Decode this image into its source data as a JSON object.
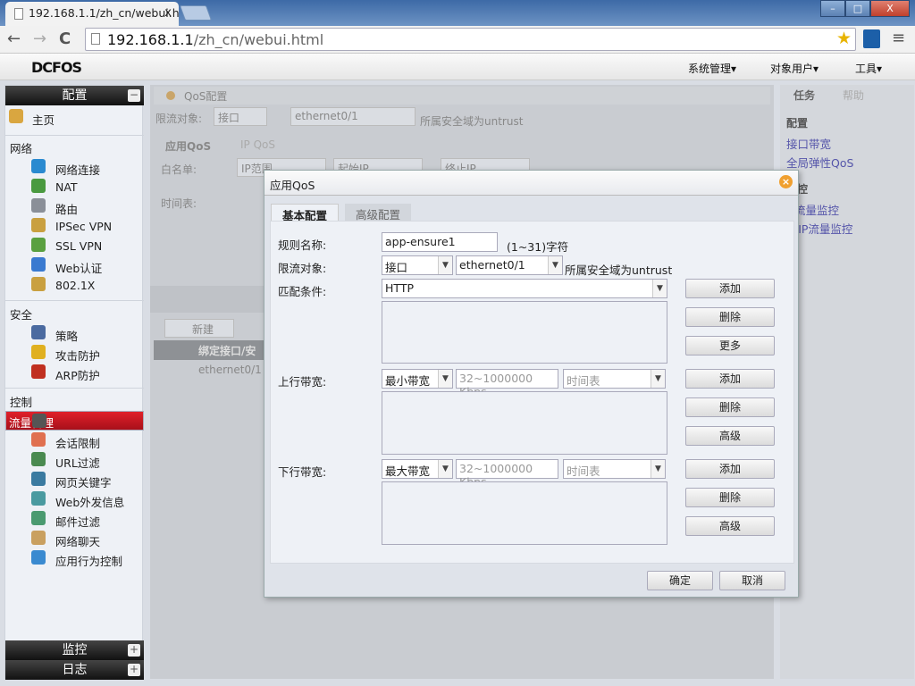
{
  "browser": {
    "tab_title": "192.168.1.1/zh_cn/webui.html",
    "tab_close": "x",
    "url_host": "192.168.1.1",
    "url_path": "/zh_cn/webui.html",
    "window_buttons": [
      "–",
      "□",
      "X"
    ]
  },
  "app": {
    "logo": "DCFOS",
    "menus": [
      "系统管理▾",
      "对象用户▾",
      "工具▾"
    ]
  },
  "sidebar": {
    "config_header": "配置",
    "home": "主页",
    "groups": [
      {
        "label": "网络",
        "items": [
          "网络连接",
          "NAT",
          "路由",
          "IPSec VPN",
          "SSL VPN",
          "Web认证",
          "802.1X"
        ]
      },
      {
        "label": "安全",
        "items": [
          "策略",
          "攻击防护",
          "ARP防护"
        ]
      },
      {
        "label": "控制",
        "items": [
          "流量管理",
          "会话限制",
          "URL过滤",
          "网页关键字",
          "Web外发信息",
          "邮件过滤",
          "网络聊天",
          "应用行为控制"
        ]
      }
    ],
    "selected": "流量管理",
    "monitor_header": "监控",
    "log_header": "日志",
    "expand": "+",
    "collapse": "−"
  },
  "main": {
    "title": "QoS配置",
    "target_label": "限流对象:",
    "target_type": "接口",
    "target_iface": "ethernet0/1",
    "zone_note": "所属安全域为untrust",
    "tabs": [
      "应用QoS",
      "IP QoS"
    ],
    "whitelist_label": "白名单:",
    "whitelist_type": "IP范围",
    "start_ip_ph": "起始IP",
    "end_ip_ph": "终止IP",
    "schedule_label": "时间表:",
    "new_button": "新建",
    "col_header": "绑定接口/安",
    "row_iface": "ethernet0/1"
  },
  "right": {
    "tabs": [
      "任务",
      "帮助"
    ],
    "config_title": "配置",
    "config_links": [
      "接口带宽",
      "全局弹性QoS"
    ],
    "monitor_title": "监控",
    "monitor_links": [
      "应用流量监控",
      "用户/IP流量监控"
    ]
  },
  "dialog": {
    "title": "应用QoS",
    "tabs": [
      "基本配置",
      "高级配置"
    ],
    "rule_name_label": "规则名称:",
    "rule_name": "app-ensure1",
    "rule_hint": "(1~31)字符",
    "target_label": "限流对象:",
    "target_type": "接口",
    "target_iface": "ethernet0/1",
    "zone_note": "所属安全域为untrust",
    "match_label": "匹配条件:",
    "match_value": "HTTP",
    "up_label": "上行带宽:",
    "up_type": "最小带宽",
    "down_label": "下行带宽:",
    "down_type": "最大带宽",
    "bw_placeholder": "32~1000000 Kbps",
    "schedule_ph": "时间表",
    "add": "添加",
    "delete": "删除",
    "more": "更多",
    "advanced": "高级",
    "ok": "确定",
    "cancel": "取消"
  }
}
